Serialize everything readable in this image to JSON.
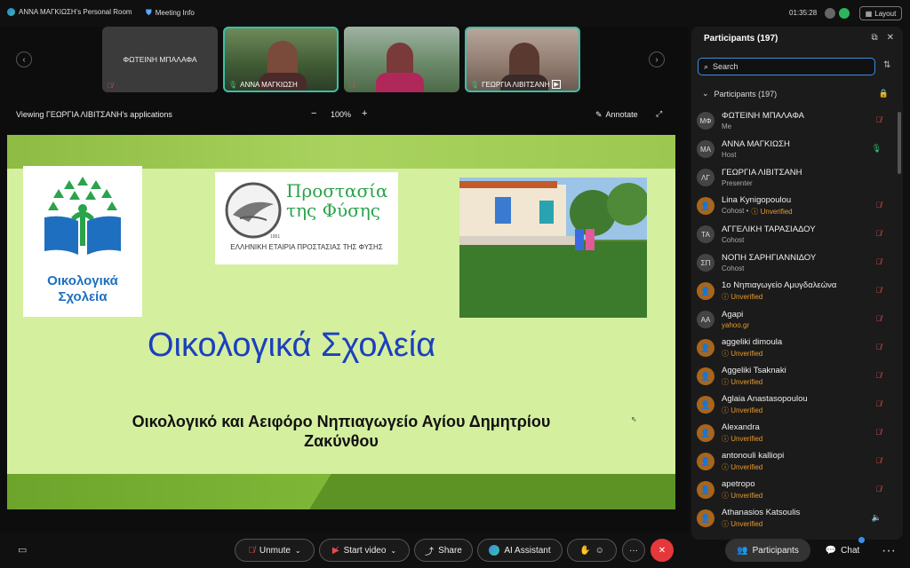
{
  "topbar": {
    "room_title": "ΑΝΝΑ ΜΑΓΚΙΩΣΗ's Personal Room",
    "meeting_info": "Meeting Info",
    "clock": "01:35:28",
    "layout_label": "Layout"
  },
  "thumbnails": [
    {
      "name": "ΦΩΤΕΙΝΗ ΜΠΑΛΑΦΑ",
      "video": false,
      "muted": true
    },
    {
      "name": "ΑΝΝΑ ΜΑΓΚΙΩΣΗ",
      "video": true,
      "muted": false
    },
    {
      "name": "",
      "video": true,
      "muted": true
    },
    {
      "name": "ΓΕΩΡΓΙΑ ΛΙΒΙΤΣΑΝΗ",
      "video": true,
      "muted": false
    }
  ],
  "viewbar": {
    "viewing_label": "Viewing ΓΕΩΡΓΙΑ ΛΙΒΙΤΣΑΝΗ's applications",
    "zoom_minus": "−",
    "zoom": "100%",
    "zoom_plus": "+",
    "annotate": "Annotate"
  },
  "slide": {
    "logo_text_1": "Οικολογικά",
    "logo_text_2": "Σχολεία",
    "org_name_1": "Προστασία",
    "org_name_2": "της Φύσης",
    "org_year": "1951",
    "org_subtitle": "ΕΛΛΗΝΙΚΗ ΕΤΑΙΡΙΑ ΠΡΟΣΤΑΣΙΑΣ ΤΗΣ ΦΥΣΗΣ",
    "title": "Οικολογικά Σχολεία",
    "subtitle_line1": "Οικολογικό και Αειφόρο Νηπιαγωγείο Αγίου Δημητρίου",
    "subtitle_line2": "Ζακύνθου"
  },
  "panel": {
    "title": "Participants (197)",
    "search_placeholder": "Search",
    "list_header": "Participants (197)",
    "participants": [
      {
        "initials": "ΜΦ",
        "name": "ΦΩΤΕΙΝΗ ΜΠΑΛΑΦΑ",
        "role": "Me",
        "unverified": "",
        "mic": "muted"
      },
      {
        "initials": "ΜΑ",
        "name": "ΑΝΝΑ ΜΑΓΚΙΩΣΗ",
        "role": "Host",
        "unverified": "",
        "mic": "on"
      },
      {
        "initials": "ΛΓ",
        "name": "ΓΕΩΡΓΙΑ ΛΙΒΙΤΣΑΝΗ",
        "role": "Presenter",
        "unverified": "",
        "mic": "none"
      },
      {
        "initials": "",
        "name": "Lina Kynigopoulou",
        "role": "Cohost •",
        "unverified": "Unverified",
        "mic": "muted"
      },
      {
        "initials": "ΤΑ",
        "name": "ΑΓΓΕΛΙΚΗ ΤΑΡΑΣΙΑΔΟΥ",
        "role": "Cohost",
        "unverified": "",
        "mic": "muted"
      },
      {
        "initials": "ΣΠ",
        "name": "ΝΟΠΗ ΣΑΡΗΓΙΑΝΝΙΔΟΥ",
        "role": "Cohost",
        "unverified": "",
        "mic": "muted"
      },
      {
        "initials": "",
        "name": "1ο Νηπιαγωγείο Αμυγδαλεώνα",
        "role": "",
        "unverified": "Unverified",
        "mic": "muted"
      },
      {
        "initials": "AA",
        "name": "Agapi",
        "role": "",
        "unverified": "yahoo.gr",
        "mic": "muted"
      },
      {
        "initials": "",
        "name": "aggeliki dimoula",
        "role": "",
        "unverified": "Unverified",
        "mic": "muted"
      },
      {
        "initials": "",
        "name": "Aggeliki Tsaknaki",
        "role": "",
        "unverified": "Unverified",
        "mic": "muted"
      },
      {
        "initials": "",
        "name": "Aglaia Anastasopoulou",
        "role": "",
        "unverified": "Unverified",
        "mic": "muted"
      },
      {
        "initials": "",
        "name": "Alexandra",
        "role": "",
        "unverified": "Unverified",
        "mic": "muted"
      },
      {
        "initials": "",
        "name": "antonouli kalliopi",
        "role": "",
        "unverified": "Unverified",
        "mic": "muted"
      },
      {
        "initials": "",
        "name": "apetropo",
        "role": "",
        "unverified": "Unverified",
        "mic": "muted"
      },
      {
        "initials": "",
        "name": "Athanasios Katsoulis",
        "role": "",
        "unverified": "Unverified",
        "mic": "speaker"
      }
    ]
  },
  "bottombar": {
    "unmute": "Unmute",
    "start_video": "Start video",
    "share": "Share",
    "ai_assistant": "AI Assistant",
    "more": "···",
    "participants": "Participants",
    "chat": "Chat"
  },
  "colors": {
    "accent": "#3a8fe8",
    "speaking_border": "#3ac0a6",
    "end_call": "#e5383b",
    "unverified": "#e89a2c",
    "slide_title": "#1c3fbf"
  }
}
